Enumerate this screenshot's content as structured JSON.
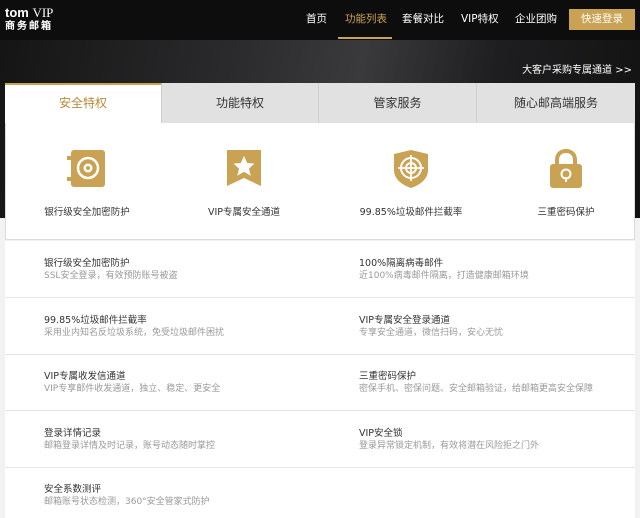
{
  "brand": {
    "line1_main": "tom",
    "line1_vip": "VIP",
    "line2": "商务邮箱"
  },
  "nav": {
    "items": [
      "首页",
      "功能列表",
      "套餐对比",
      "VIP特权",
      "企业团购"
    ],
    "active_index": 1,
    "login_label": "快速登录"
  },
  "vip_link": "大客户采购专属通道 >>",
  "tabs": [
    "安全特权",
    "功能特权",
    "管家服务",
    "随心邮高端服务"
  ],
  "active_tab": 0,
  "features": [
    {
      "icon": "safe-icon",
      "caption": "银行级安全加密防护"
    },
    {
      "icon": "vip-star-icon",
      "caption": "VIP专属安全通道"
    },
    {
      "icon": "shield-target-icon",
      "caption": "99.85%垃圾邮件拦截率"
    },
    {
      "icon": "padlock-icon",
      "caption": "三重密码保护"
    }
  ],
  "details": [
    {
      "title": "银行级安全加密防护",
      "desc": "SSL安全登录，有效预防账号被盗"
    },
    {
      "title": "100%隔离病毒邮件",
      "desc": "近100%病毒邮件隔离，打造健康邮箱环境"
    },
    {
      "title": "99.85%垃圾邮件拦截率",
      "desc": "采用业内知名反垃圾系统，免受垃圾邮件困扰"
    },
    {
      "title": "VIP专属安全登录通道",
      "desc": "专享安全通道，微信扫码，安心无忧"
    },
    {
      "title": "VIP专属收发信通道",
      "desc": "VIP专享邮件收发通道，独立、稳定、更安全"
    },
    {
      "title": "三重密码保护",
      "desc": "密保手机、密保问题、安全邮箱验证，给邮箱更高安全保障"
    },
    {
      "title": "登录详情记录",
      "desc": "邮箱登录详情及时记录，账号动态随时掌控"
    },
    {
      "title": "VIP安全锁",
      "desc": "登录异常锁定机制，有效将潜在风险拒之门外"
    },
    {
      "title": "安全系数测评",
      "desc": "邮箱账号状态检测，360°安全管家式防护"
    }
  ],
  "colors": {
    "accent": "#c9a253",
    "header": "#0d0d0d"
  }
}
